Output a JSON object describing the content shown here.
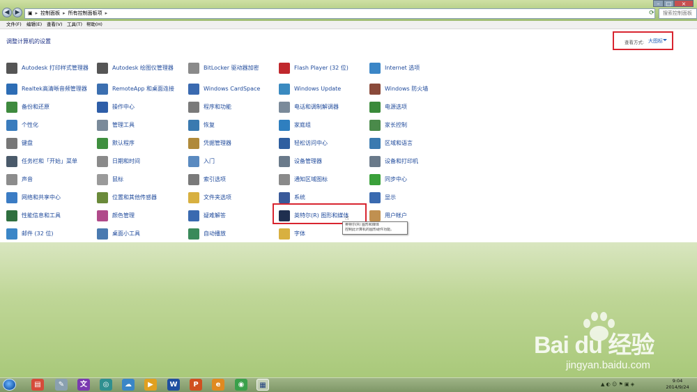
{
  "window": {
    "breadcrumb": [
      "控制面板",
      "所有控制面板项"
    ],
    "search_placeholder": "搜索控制面板"
  },
  "menu": [
    "文件(F)",
    "编辑(E)",
    "查看(V)",
    "工具(T)",
    "帮助(H)"
  ],
  "header": {
    "title": "调整计算机的设置",
    "view_by_label": "查看方式:",
    "view_by_value": "大图标"
  },
  "items": [
    {
      "label": "Autodesk 打印样式管理器",
      "icon": "printer-style-icon",
      "color": "#555555"
    },
    {
      "label": "Realtek高清晰音频管理器",
      "icon": "audio-manager-icon",
      "color": "#2d6db5"
    },
    {
      "label": "备份和还原",
      "icon": "backup-restore-icon",
      "color": "#3e8a3e"
    },
    {
      "label": "个性化",
      "icon": "personalization-icon",
      "color": "#3a7cbd"
    },
    {
      "label": "键盘",
      "icon": "keyboard-icon",
      "color": "#777777"
    },
    {
      "label": "任务栏和「开始」菜单",
      "icon": "taskbar-icon",
      "color": "#4a5a6a"
    },
    {
      "label": "声音",
      "icon": "sound-icon",
      "color": "#8c8c8c"
    },
    {
      "label": "网络和共享中心",
      "icon": "network-center-icon",
      "color": "#3b7cc4"
    },
    {
      "label": "性能信息和工具",
      "icon": "performance-icon",
      "color": "#2f6f3f"
    },
    {
      "label": "邮件 (32 位)",
      "icon": "mail-icon",
      "color": "#3b86c7"
    },
    {
      "label": "Autodesk 绘图仪管理器",
      "icon": "plotter-icon",
      "color": "#555555"
    },
    {
      "label": "RemoteApp 和桌面连接",
      "icon": "remote-desktop-icon",
      "color": "#3b6fb0"
    },
    {
      "label": "操作中心",
      "icon": "action-center-flag-icon",
      "color": "#2e5ea8"
    },
    {
      "label": "管理工具",
      "icon": "admin-tools-icon",
      "color": "#7a8a9a"
    },
    {
      "label": "默认程序",
      "icon": "default-programs-icon",
      "color": "#3f8f3f"
    },
    {
      "label": "日期和时间",
      "icon": "date-time-icon",
      "color": "#8a8a8a"
    },
    {
      "label": "鼠标",
      "icon": "mouse-icon",
      "color": "#9a9a9a"
    },
    {
      "label": "位置和其他传感器",
      "icon": "location-sensor-icon",
      "color": "#6a8a3a"
    },
    {
      "label": "颜色管理",
      "icon": "color-management-icon",
      "color": "#b04a8a"
    },
    {
      "label": "桌面小工具",
      "icon": "gadgets-icon",
      "color": "#4a7ab0"
    },
    {
      "label": "BitLocker 驱动器加密",
      "icon": "bitlocker-icon",
      "color": "#8a8a8a"
    },
    {
      "label": "Windows CardSpace",
      "icon": "cardspace-icon",
      "color": "#3a6ab0"
    },
    {
      "label": "程序和功能",
      "icon": "programs-features-icon",
      "color": "#7a7a7a"
    },
    {
      "label": "恢复",
      "icon": "recovery-icon",
      "color": "#3a7ab0"
    },
    {
      "label": "凭据管理器",
      "icon": "credential-manager-icon",
      "color": "#b08a3a"
    },
    {
      "label": "入门",
      "icon": "getting-started-icon",
      "color": "#5a8ac0"
    },
    {
      "label": "索引选项",
      "icon": "indexing-icon",
      "color": "#7a7a7a"
    },
    {
      "label": "文件夹选项",
      "icon": "folder-options-icon",
      "color": "#d8b040"
    },
    {
      "label": "疑难解答",
      "icon": "troubleshooting-icon",
      "color": "#3a6ab0"
    },
    {
      "label": "自动播放",
      "icon": "autoplay-icon",
      "color": "#3a8a5a"
    },
    {
      "label": "Flash Player (32 位)",
      "icon": "flash-player-icon",
      "color": "#c0282d"
    },
    {
      "label": "Windows Update",
      "icon": "windows-update-icon",
      "color": "#3a8ac0"
    },
    {
      "label": "电话和调制解调器",
      "icon": "phone-modem-icon",
      "color": "#7a8a9a"
    },
    {
      "label": "家庭组",
      "icon": "homegroup-icon",
      "color": "#2f7fbf"
    },
    {
      "label": "轻松访问中心",
      "icon": "ease-of-access-icon",
      "color": "#2f5fa0"
    },
    {
      "label": "设备管理器",
      "icon": "device-manager-icon",
      "color": "#6a7a8a"
    },
    {
      "label": "通知区域图标",
      "icon": "notification-icons-icon",
      "color": "#8a8a8a"
    },
    {
      "label": "系统",
      "icon": "system-icon",
      "color": "#3a5a9a"
    },
    {
      "label": "英特尔(R) 图形和媒体",
      "icon": "intel-graphics-icon",
      "color": "#1f2f4f"
    },
    {
      "label": "字体",
      "icon": "fonts-icon",
      "color": "#d8b040"
    },
    {
      "label": "Internet 选项",
      "icon": "internet-options-icon",
      "color": "#3b86c7"
    },
    {
      "label": "Windows 防火墙",
      "icon": "firewall-icon",
      "color": "#8a4a3a"
    },
    {
      "label": "电源选项",
      "icon": "power-options-icon",
      "color": "#3a8a3a"
    },
    {
      "label": "家长控制",
      "icon": "parental-controls-icon",
      "color": "#4a8a4a"
    },
    {
      "label": "区域和语言",
      "icon": "region-language-icon",
      "color": "#3a7ab0"
    },
    {
      "label": "设备和打印机",
      "icon": "devices-printers-icon",
      "color": "#6a7a8a"
    },
    {
      "label": "同步中心",
      "icon": "sync-center-icon",
      "color": "#3aa03a"
    },
    {
      "label": "显示",
      "icon": "display-icon",
      "color": "#3a6ab0"
    },
    {
      "label": "用户帐户",
      "icon": "user-accounts-icon",
      "color": "#c09050"
    }
  ],
  "tooltip": {
    "title": "英特尔(R) 图形和媒体",
    "description": "控制此计算机的图形硬件功能。"
  },
  "watermark": {
    "brand": "Bai du 经验",
    "url": "jingyan.baidu.com"
  },
  "taskbar": {
    "apps": [
      "start-orb",
      "folder-app",
      "browser-app",
      "text-app",
      "network-app",
      "cloud-app",
      "media-app",
      "word-app",
      "powerpoint-app",
      "ie-app",
      "video-app",
      "control-panel-app"
    ],
    "time": "9:04",
    "date": "2014/9/24"
  },
  "colors": {
    "link": "#1f4a9b",
    "highlight": "#d8242f"
  }
}
